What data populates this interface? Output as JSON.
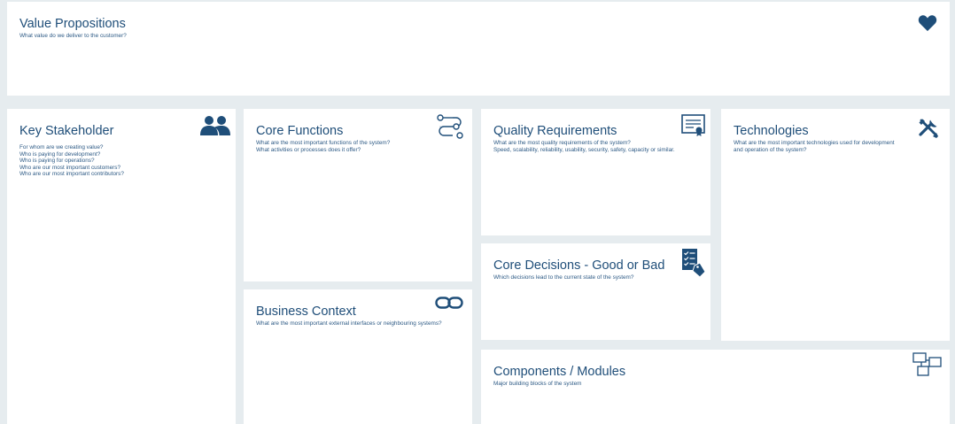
{
  "cards": {
    "value": {
      "title": "Value Propositions",
      "lines": [
        "What value do we deliver to the customer?"
      ],
      "icon": "heart-icon"
    },
    "stakeholder": {
      "title": "Key Stakeholder",
      "lines": [
        "For whom are we creating value?",
        "Who is paying for development?",
        "Who is paying for operations?",
        "Who are our most important customers?",
        "Who are our most important contributors?"
      ],
      "icon": "users-icon"
    },
    "core_functions": {
      "title": "Core Functions",
      "lines": [
        "What are the most important functions of the system?",
        "What activities or processes does it offer?"
      ],
      "icon": "process-flow-icon"
    },
    "quality": {
      "title": "Quality Requirements",
      "lines": [
        "What are the most quality requirements of the system?",
        "Speed, scalability, reliability, usability, security, safety, capacity or similar."
      ],
      "icon": "certificate-icon"
    },
    "technologies": {
      "title": "Technologies",
      "lines": [
        "What are the most important technologies used for development",
        "and operation of the system?"
      ],
      "icon": "tools-icon"
    },
    "decisions": {
      "title": "Core Decisions - Good or Bad",
      "lines": [
        "Which decisions lead to the current state of the system?"
      ],
      "icon": "checklist-tag-icon"
    },
    "business": {
      "title": "Business Context",
      "lines": [
        "What are the most important external interfaces or neighbouring systems?"
      ],
      "icon": "link-icon"
    },
    "components": {
      "title": "Components / Modules",
      "lines": [
        "Major building blocks of the system"
      ],
      "icon": "modules-icon"
    }
  },
  "colors": {
    "accent": "#1f4e79",
    "background": "#e6ecef",
    "card": "#ffffff"
  }
}
